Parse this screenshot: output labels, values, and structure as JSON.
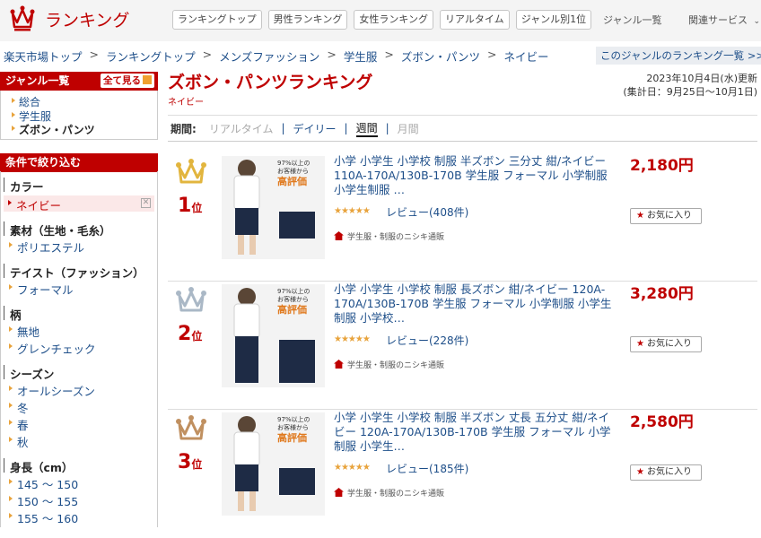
{
  "header": {
    "logo_text": "ランキング",
    "nav_tabs": [
      "ランキングトップ",
      "男性ランキング",
      "女性ランキング",
      "リアルタイム",
      "ジャンル別1位"
    ],
    "genre_link": "ジャンル一覧",
    "services_link": "関連サービス"
  },
  "breadcrumb": [
    "楽天市場トップ",
    "ランキングトップ",
    "メンズファッション",
    "学生服",
    "ズボン・パンツ",
    "ネイビー"
  ],
  "genre_ranking_link": "このジャンルのランキング一覧 >>",
  "sidebar": {
    "genre_title": "ジャンル一覧",
    "see_all": "全て見る",
    "genres": [
      "総合",
      "学生服",
      "ズボン・パンツ"
    ],
    "filter_title": "条件で絞り込む",
    "filters": [
      {
        "title": "カラー",
        "selected": "ネイビー",
        "items": []
      },
      {
        "title": "素材（生地・毛糸）",
        "items": [
          "ポリエステル"
        ]
      },
      {
        "title": "テイスト（ファッション）",
        "items": [
          "フォーマル"
        ]
      },
      {
        "title": "柄",
        "items": [
          "無地",
          "グレンチェック"
        ]
      },
      {
        "title": "シーズン",
        "items": [
          "オールシーズン",
          "冬",
          "春",
          "秋"
        ]
      },
      {
        "title": "身長（cm）",
        "items": [
          "145 ～ 150",
          "150 ～ 155",
          "155 ～ 160"
        ]
      }
    ]
  },
  "main": {
    "title": "ズボン・パンツランキング",
    "subtitle": "ネイビー",
    "updated": "2023年10月4日(水)更新",
    "period_range": "(集計日：9月25日～10月1日)",
    "period_label": "期間:",
    "period_options": [
      "リアルタイム",
      "デイリー",
      "週間",
      "月間"
    ],
    "thumb_badge_top": "97%以上の",
    "thumb_badge_mid": "お客様から",
    "thumb_badge_main": "高評価",
    "items": [
      {
        "rank": "1",
        "rank_suffix": "位",
        "crown_color": "#e2b53e",
        "name": "小学 小学生 小学校 制服 半ズボン 三分丈 紺/ネイビー 110A-170A/130B-170B 学生服 フォーマル 小学制服 小学生制服 …",
        "price": "2,180円",
        "stars": "★★★★★",
        "review": "レビュー(408件)",
        "shop": "学生服・制服のニシキ通販",
        "fav": "お気に入り"
      },
      {
        "rank": "2",
        "rank_suffix": "位",
        "crown_color": "#aab8c6",
        "name": "小学 小学生 小学校 制服 長ズボン 紺/ネイビー 120A-170A/130B-170B 学生服 フォーマル 小学制服 小学生制服 小学校…",
        "price": "3,280円",
        "stars": "★★★★★",
        "review": "レビュー(228件)",
        "shop": "学生服・制服のニシキ通販",
        "fav": "お気に入り"
      },
      {
        "rank": "3",
        "rank_suffix": "位",
        "crown_color": "#c09060",
        "name": "小学 小学生 小学校 制服 半ズボン 丈長 五分丈 紺/ネイビー 120A-170A/130B-170B 学生服 フォーマル 小学制服 小学生…",
        "price": "2,580円",
        "stars": "★★★★★",
        "review": "レビュー(185件)",
        "shop": "学生服・制服のニシキ通販",
        "fav": "お気に入り"
      }
    ]
  }
}
